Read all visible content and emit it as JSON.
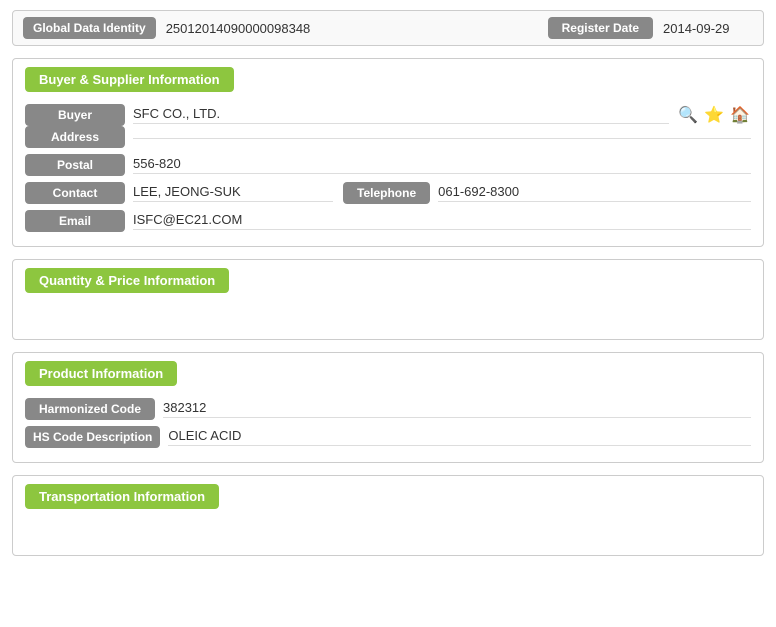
{
  "globalIdentity": {
    "label": "Global Data Identity",
    "value": "25012014090000098348",
    "registerLabel": "Register Date",
    "registerValue": "2014-09-29"
  },
  "buyerSupplier": {
    "header": "Buyer & Supplier Information",
    "fields": {
      "buyerLabel": "Buyer",
      "buyerValue": "SFC CO., LTD.",
      "addressLabel": "Address",
      "addressValue": "",
      "postalLabel": "Postal",
      "postalValue": "556-820",
      "contactLabel": "Contact",
      "contactValue": "LEE, JEONG-SUK",
      "telephoneLabel": "Telephone",
      "telephoneValue": "061-692-8300",
      "emailLabel": "Email",
      "emailValue": "ISFC@EC21.COM"
    },
    "icons": {
      "search": "🔍",
      "star": "⭐",
      "home": "🏠"
    }
  },
  "quantityPrice": {
    "header": "Quantity & Price Information"
  },
  "productInfo": {
    "header": "Product Information",
    "fields": {
      "harmonizedCodeLabel": "Harmonized Code",
      "harmonizedCodeValue": "382312",
      "hsDescLabel": "HS Code Description",
      "hsDescValue": "OLEIC ACID"
    }
  },
  "transportation": {
    "header": "Transportation Information"
  }
}
